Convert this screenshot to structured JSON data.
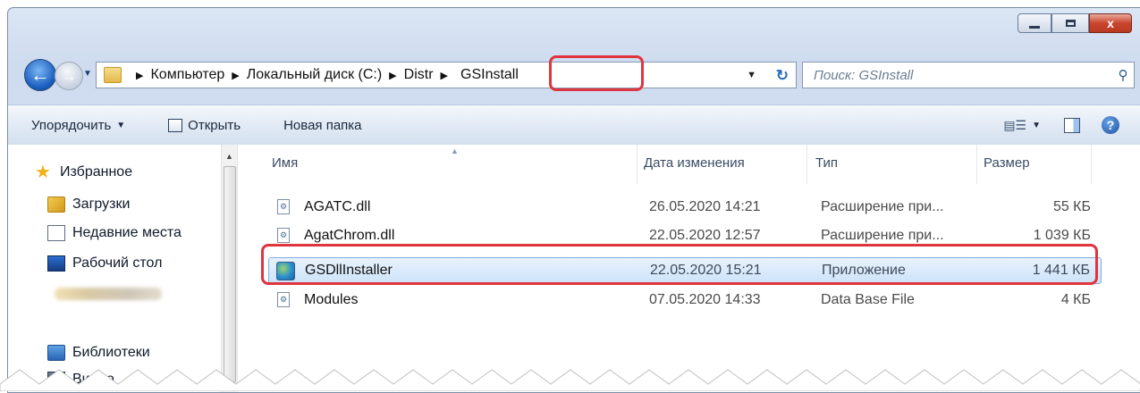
{
  "window": {
    "controls": {
      "minimize": "",
      "maximize": "",
      "close": "x"
    }
  },
  "address": {
    "crumbs": [
      "Компьютер",
      "Локальный диск (C:)",
      "Distr"
    ],
    "current": "GSInstall"
  },
  "search": {
    "placeholder": "Поиск: GSInstall"
  },
  "toolbar": {
    "organize": "Упорядочить",
    "open": "Открыть",
    "new_folder": "Новая папка"
  },
  "nav": {
    "favorites": "Избранное",
    "downloads": "Загрузки",
    "recent": "Недавние места",
    "desktop": "Рабочий стол",
    "libraries": "Библиотеки",
    "video": "Видео"
  },
  "columns": {
    "name": "Имя",
    "date": "Дата изменения",
    "type": "Тип",
    "size": "Размер"
  },
  "files": [
    {
      "name": "AGATC.dll",
      "date": "26.05.2020 14:21",
      "type": "Расширение при...",
      "size": "55 КБ"
    },
    {
      "name": "AgatChrom.dll",
      "date": "22.05.2020 12:57",
      "type": "Расширение при...",
      "size": "1 039 КБ"
    },
    {
      "name": "GSDllInstaller",
      "date": "22.05.2020 15:21",
      "type": "Приложение",
      "size": "1 441 КБ"
    },
    {
      "name": "Modules",
      "date": "07.05.2020 14:33",
      "type": "Data Base File",
      "size": "4 КБ"
    }
  ],
  "colors": {
    "highlight": "#e0343f",
    "selection": "#cde3f9"
  }
}
